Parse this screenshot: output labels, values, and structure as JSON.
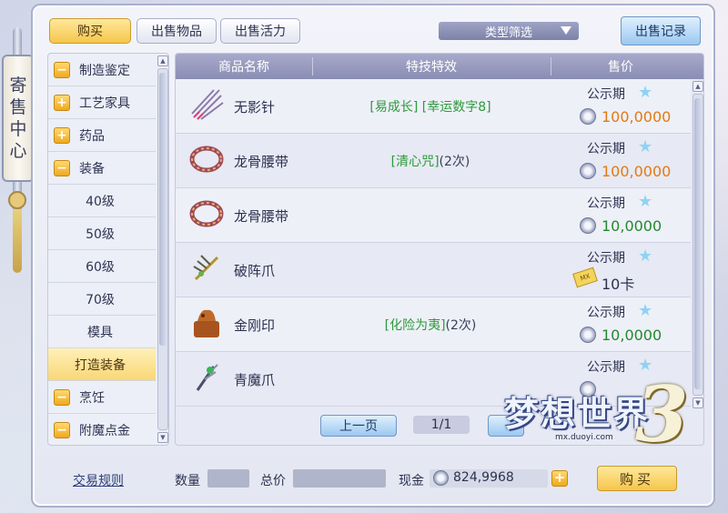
{
  "side_tab": {
    "chars": [
      "寄",
      "售",
      "中",
      "心"
    ]
  },
  "tabs": [
    {
      "label": "购买",
      "active": true
    },
    {
      "label": "出售物品",
      "active": false
    },
    {
      "label": "出售活力",
      "active": false
    }
  ],
  "filter": {
    "label": "类型筛选"
  },
  "sell_record_label": "出售记录",
  "categories": [
    {
      "label": "制造鉴定",
      "sign": "−"
    },
    {
      "label": "工艺家具",
      "sign": "+"
    },
    {
      "label": "药品",
      "sign": "+"
    },
    {
      "label": "装备",
      "sign": "−"
    },
    {
      "label": "40级",
      "sign": ""
    },
    {
      "label": "50级",
      "sign": ""
    },
    {
      "label": "60级",
      "sign": ""
    },
    {
      "label": "70级",
      "sign": ""
    },
    {
      "label": "模具",
      "sign": ""
    },
    {
      "label": "打造装备",
      "sign": "",
      "selected": true
    },
    {
      "label": "烹饪",
      "sign": "−"
    },
    {
      "label": "附魔点金",
      "sign": "−"
    }
  ],
  "table": {
    "headers": [
      "商品名称",
      "特技特效",
      "售价"
    ],
    "rows": [
      {
        "icon": "needle-weapon-icon",
        "name": "无影针",
        "effect_green": "[易成长] [幸运数字8]",
        "effect_suffix": "",
        "status": "公示期",
        "price": "100,0000",
        "price_color": "orange",
        "price_type": "coin"
      },
      {
        "icon": "dragon-belt-icon",
        "name": "龙骨腰带",
        "effect_green": "[清心咒]",
        "effect_suffix": "(2次)",
        "status": "公示期",
        "price": "100,0000",
        "price_color": "orange",
        "price_type": "coin"
      },
      {
        "icon": "dragon-belt-icon",
        "name": "龙骨腰带",
        "effect_green": "",
        "effect_suffix": "",
        "status": "公示期",
        "price": "10,0000",
        "price_color": "green",
        "price_type": "coin"
      },
      {
        "icon": "claw-weapon-icon",
        "name": "破阵爪",
        "effect_green": "",
        "effect_suffix": "",
        "status": "公示期",
        "price": "10卡",
        "price_color": "dark",
        "price_type": "mx-card",
        "card_text": "MX"
      },
      {
        "icon": "seal-icon",
        "name": "金刚印",
        "effect_green": "[化险为夷]",
        "effect_suffix": "(2次)",
        "status": "公示期",
        "price": "10,0000",
        "price_color": "green",
        "price_type": "coin"
      },
      {
        "icon": "demon-claw-icon",
        "name": "青魔爪",
        "effect_green": "",
        "effect_suffix": "",
        "status": "公示期",
        "price": "",
        "price_color": "green",
        "price_type": "coin"
      }
    ]
  },
  "pager": {
    "prev_label": "上一页",
    "page": "1/1"
  },
  "bottom": {
    "rules_label": "交易规则",
    "qty_label": "数量",
    "total_label": "总价",
    "cash_label": "现金",
    "cash_value": "824,9968",
    "buy_label": "购买"
  },
  "logo": {
    "text": "梦想世界",
    "number": "3",
    "url": "mx.duoyi.com"
  }
}
